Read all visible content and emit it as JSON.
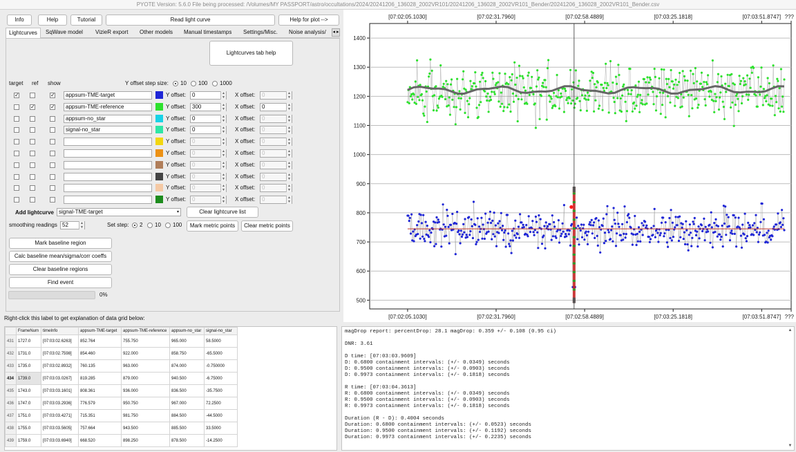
{
  "title": "PYOTE Version: 5.6.0  File being processed: /Volumes/MY PASSPORT/astro/occultations/2024/20241206_136028_2002VR101/20241206_136028_2002VR101_Bender/20241206_136028_2002VR101_Bender.csv",
  "top_buttons": {
    "info": "Info",
    "help": "Help",
    "tutorial": "Tutorial",
    "read": "Read light curve",
    "help_plot": "Help for plot -->"
  },
  "tabs": [
    "Lightcurves",
    "SqWave model",
    "VizieR export",
    "Other models",
    "Manual timestamps",
    "Settings/Misc.",
    "Noise analysis/"
  ],
  "tab_arrows": "◂ ▸",
  "lightcurves_help": "Lightcurves tab help",
  "col_headers": {
    "target": "target",
    "ref": "ref",
    "show": "show"
  },
  "yoffset_step": {
    "label": "Y offset step size:",
    "options": [
      "10",
      "100",
      "1000"
    ]
  },
  "row_labels": {
    "y": "Y offset:",
    "x": "X offset:"
  },
  "curves": [
    {
      "name": "appsum-TME-target",
      "color": "#1f26d6",
      "y": "0",
      "x": "0",
      "target": "✓",
      "ref": "",
      "show": "✓",
      "active": true,
      "xactive": false
    },
    {
      "name": "appsum-TME-reference",
      "color": "#2ee12e",
      "y": "300",
      "x": "0",
      "target": "",
      "ref": "✓",
      "show": "✓",
      "active": true,
      "xactive": true
    },
    {
      "name": "appsum-no_star",
      "color": "#19d2e6",
      "y": "0",
      "x": "0",
      "target": "",
      "ref": "",
      "show": "",
      "active": true,
      "xactive": false
    },
    {
      "name": "signal-no_star",
      "color": "#2ee6a6",
      "y": "0",
      "x": "0",
      "target": "",
      "ref": "",
      "show": "",
      "active": true,
      "xactive": false
    },
    {
      "name": "",
      "color": "#f2d60f",
      "y": "0",
      "x": "0",
      "target": "",
      "ref": "",
      "show": "",
      "active": false,
      "xactive": false
    },
    {
      "name": "",
      "color": "#ec9114",
      "y": "0",
      "x": "0",
      "target": "",
      "ref": "",
      "show": "",
      "active": false,
      "xactive": false
    },
    {
      "name": "",
      "color": "#b07e5a",
      "y": "0",
      "x": "0",
      "target": "",
      "ref": "",
      "show": "",
      "active": false,
      "xactive": false
    },
    {
      "name": "",
      "color": "#444444",
      "y": "0",
      "x": "0",
      "target": "",
      "ref": "",
      "show": "",
      "active": false,
      "xactive": false
    },
    {
      "name": "",
      "color": "#f5c9a4",
      "y": "0",
      "x": "0",
      "target": "",
      "ref": "",
      "show": "",
      "active": false,
      "xactive": false
    },
    {
      "name": "",
      "color": "#1d8c1d",
      "y": "0",
      "x": "0",
      "target": "",
      "ref": "",
      "show": "",
      "active": false,
      "xactive": false
    }
  ],
  "add_lightcurve": {
    "label": "Add lightcurve",
    "value": "signal-TME-target",
    "clear": "Clear lightcurve list"
  },
  "smoothing": {
    "label": "smoothing readings",
    "value": "52"
  },
  "set_step": {
    "label": "Set step:",
    "options": [
      "2",
      "10",
      "100"
    ]
  },
  "metric_buttons": {
    "mark": "Mark metric points",
    "clear": "Clear metric points"
  },
  "left_buttons": [
    "Mark baseline region",
    "Calc baseline mean/sigma/corr coeffs",
    "Clear baseline regions",
    "Find event"
  ],
  "progress": {
    "value": 0,
    "label": "0%"
  },
  "grid_label": "Right-click this label to get explanation of data grid below:",
  "grid": {
    "headers": [
      "FrameNum",
      "timeInfo",
      "appsum-TME-target",
      "appsum-TME-reference",
      "appsum-no_star",
      "signal-no_star"
    ],
    "selected_row": "434",
    "rows": [
      [
        "431",
        "1727.0",
        "[07:03:02.6263]",
        "852.764",
        "755.750",
        "965.000",
        "58.5000"
      ],
      [
        "432",
        "1731.0",
        "[07:03:02.7598]",
        "854.460",
        "922.000",
        "858.750",
        "-65.5000"
      ],
      [
        "433",
        "1735.0",
        "[07:03:02.8932]",
        "760.135",
        "963.000",
        "874.000",
        "-0.750000"
      ],
      [
        "434",
        "1739.0",
        "[07:03:03.0267]",
        "819.285",
        "879.000",
        "940.500",
        "-6.75000"
      ],
      [
        "435",
        "1743.0",
        "[07:03:03.1601]",
        "808.361",
        "936.000",
        "836.500",
        "-35.7500"
      ],
      [
        "436",
        "1747.0",
        "[07:03:03.2936]",
        "776.579",
        "950.750",
        "967.000",
        "72.2500"
      ],
      [
        "437",
        "1751.0",
        "[07:03:03.4271]",
        "715.351",
        "981.750",
        "884.500",
        "-44.5000"
      ],
      [
        "438",
        "1755.0",
        "[07:03:03.5605]",
        "757.664",
        "943.500",
        "885.500",
        "33.5000"
      ],
      [
        "439",
        "1759.0",
        "[07:03:03.6940]",
        "668.520",
        "898.250",
        "878.500",
        "-14.2500"
      ]
    ]
  },
  "plot": {
    "top_ticks": [
      "[07:02:05.1030]",
      "[07:02:31.7960]",
      "[07:02:58.4889]",
      "[07:03:25.1818]",
      "[07:03:51.8747]",
      "???"
    ],
    "bottom_ticks": [
      "[07:02:05.1030]",
      "[07:02:31.7960]",
      "[07:02:58.4889]",
      "[07:03:25.1818]",
      "[07:03:51.8747]",
      "???"
    ],
    "y_ticks": [
      "1400",
      "1300",
      "1200",
      "1100",
      "1000",
      "900",
      "800",
      "700",
      "600",
      "500"
    ]
  },
  "chart_data": {
    "type": "scatter",
    "title": "",
    "xlabel": "",
    "ylabel": "",
    "ylim": [
      470,
      1450
    ],
    "grid": true,
    "series": [
      {
        "color": "#2ee12e",
        "mean": 1220,
        "sigma": 75,
        "smooth_mean": 1222
      },
      {
        "color": "#1f26d6",
        "mean": 745,
        "sigma": 55,
        "baseline": 745
      }
    ],
    "event_time": "[07:03:03.9609] – [07:03:04.3613]"
  },
  "report_lines": [
    "magDrop report: percentDrop: 28.1 magDrop: 0.359 +/- 0.108 (0.95 ci)",
    "",
    "DNR: 3.61",
    "",
    "D time: [07:03:03.9609]",
    "D: 0.6800 containment intervals: (+/- 0.0349) seconds",
    "D: 0.9500 containment intervals: (+/- 0.0903) seconds",
    "D: 0.9973 containment intervals: (+/- 0.1818) seconds",
    "",
    "R time: [07:03:04.3613]",
    "R: 0.6800 containment intervals: (+/- 0.0349) seconds",
    "R: 0.9500 containment intervals: (+/- 0.0903) seconds",
    "R: 0.9973 containment intervals: (+/- 0.1818) seconds",
    "",
    "Duration (R - D): 0.4004 seconds",
    "Duration: 0.6800 containment intervals: (+/- 0.0523) seconds",
    "Duration: 0.9500 containment intervals: (+/- 0.1192) seconds",
    "Duration: 0.9973 containment intervals: (+/- 0.2235) seconds"
  ]
}
